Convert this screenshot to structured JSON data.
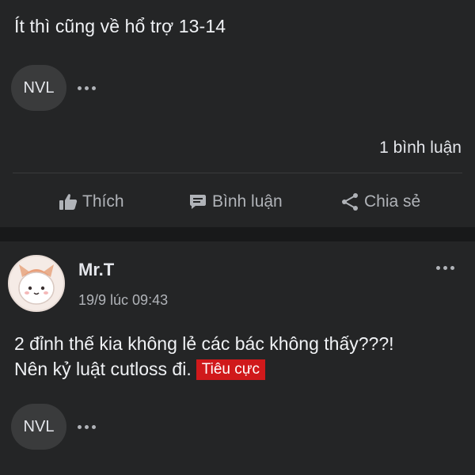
{
  "post1": {
    "text": "Ít thì cũng về hổ trợ 13-14",
    "reaction_badge": "NVL",
    "comment_count": "1 bình luận"
  },
  "actions": {
    "like": "Thích",
    "comment": "Bình luận",
    "share": "Chia sẻ"
  },
  "post2": {
    "author": "Mr.T",
    "timestamp": "19/9 lúc 09:43",
    "line1": "2 đỉnh thế kia không lẻ các bác không thấy???!",
    "line2": "Nên kỷ luật cutloss đi.",
    "tag": "Tiêu cực",
    "tag_color": "#d0191b",
    "reaction_badge": "NVL"
  },
  "icons": {
    "like": "thumbs-up-icon",
    "comment": "comment-icon",
    "share": "share-icon",
    "more": "more-dots-icon"
  }
}
